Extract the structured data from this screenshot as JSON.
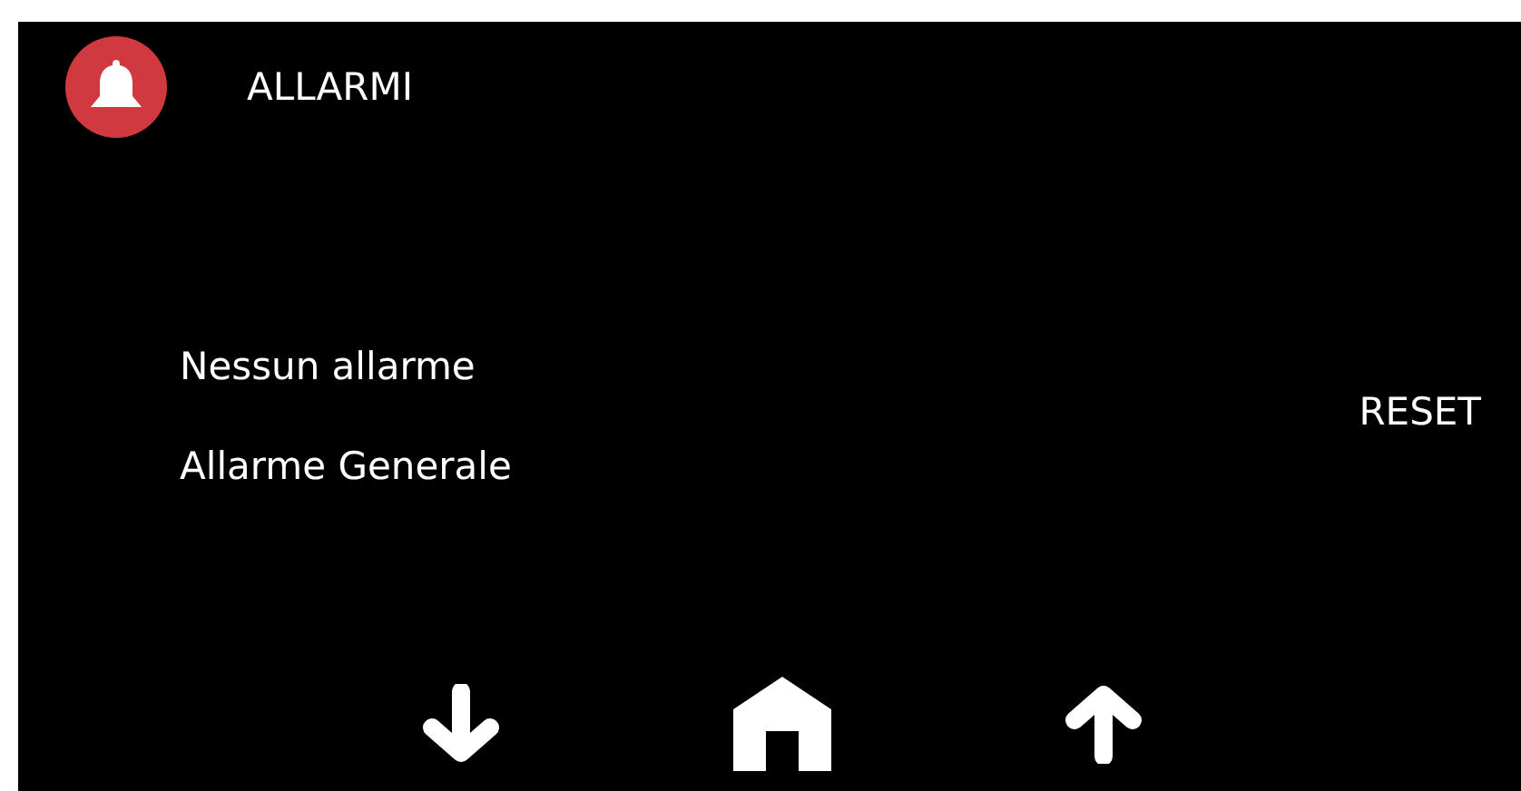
{
  "header": {
    "title": "ALLARMI"
  },
  "alarms": [
    {
      "text": "Nessun allarme"
    },
    {
      "text": "Allarme Generale"
    }
  ],
  "reset_button": {
    "label": "RESET"
  },
  "nav": [
    {
      "kind": "down"
    },
    {
      "kind": "home"
    },
    {
      "kind": "up"
    }
  ]
}
